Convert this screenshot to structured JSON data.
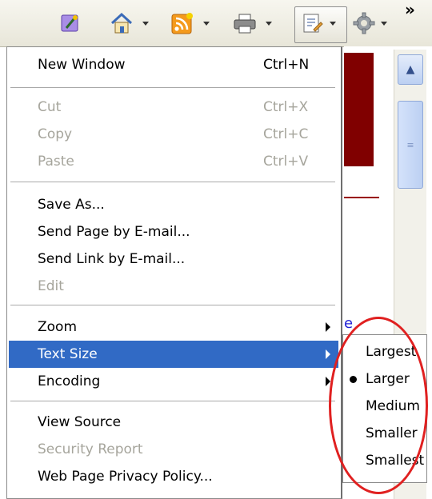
{
  "toolbar": {
    "buttons": [
      {
        "name": "favorites",
        "icon": "favorites-icon"
      },
      {
        "name": "home",
        "icon": "home-icon"
      },
      {
        "name": "feeds",
        "icon": "rss-feed-icon"
      },
      {
        "name": "print",
        "icon": "printer-icon"
      },
      {
        "name": "page",
        "icon": "page-icon"
      },
      {
        "name": "tools",
        "icon": "gear-icon"
      }
    ],
    "overflow": "»"
  },
  "menu": {
    "new_window": {
      "label": "New Window",
      "shortcut": "Ctrl+N"
    },
    "cut": {
      "label": "Cut",
      "shortcut": "Ctrl+X"
    },
    "copy": {
      "label": "Copy",
      "shortcut": "Ctrl+C"
    },
    "paste": {
      "label": "Paste",
      "shortcut": "Ctrl+V"
    },
    "save_as": {
      "label": "Save As..."
    },
    "send_page": {
      "label": "Send Page by E-mail..."
    },
    "send_link": {
      "label": "Send Link by E-mail..."
    },
    "edit": {
      "label": "Edit"
    },
    "zoom": {
      "label": "Zoom"
    },
    "text_size": {
      "label": "Text Size"
    },
    "encoding": {
      "label": "Encoding"
    },
    "view_source": {
      "label": "View Source"
    },
    "security_report": {
      "label": "Security Report"
    },
    "privacy_policy": {
      "label": "Web Page Privacy Policy..."
    }
  },
  "text_size_submenu": {
    "items": [
      "Largest",
      "Larger",
      "Medium",
      "Smaller",
      "Smallest"
    ],
    "selected": "Larger"
  },
  "colors": {
    "highlight": "#316ac5",
    "annotation": "#e02020"
  }
}
